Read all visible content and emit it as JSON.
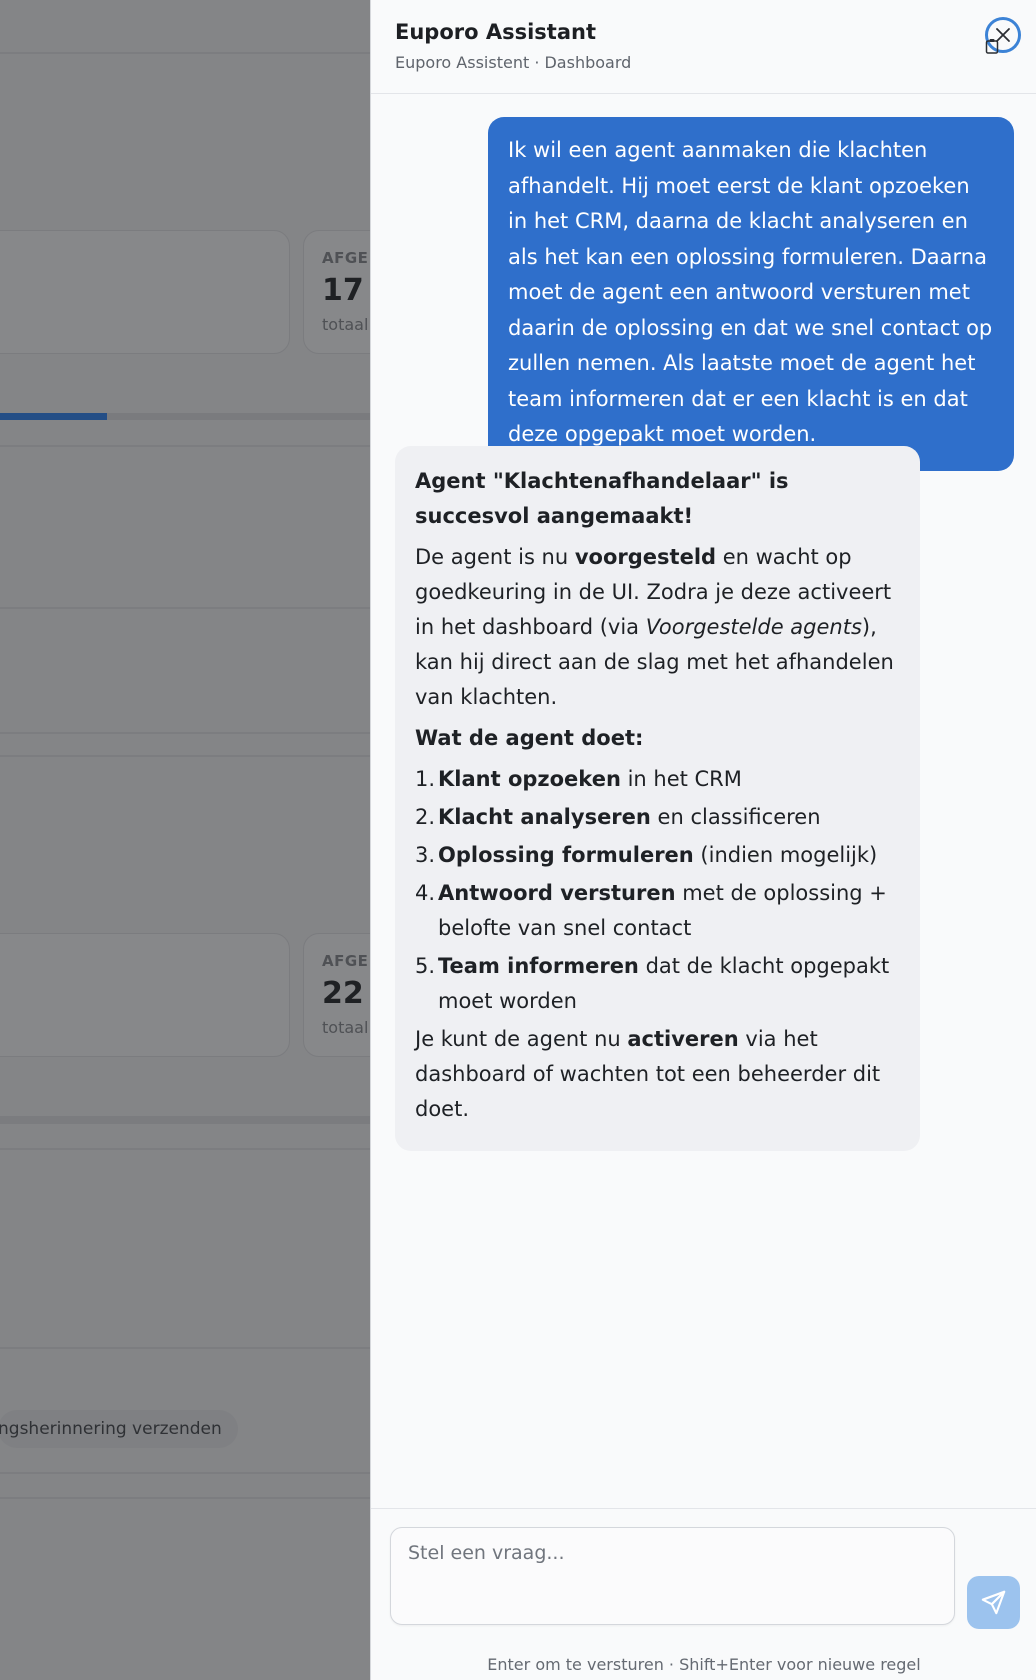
{
  "background": {
    "stat_cards": [
      {
        "label": "AFGE",
        "value": "17",
        "sub": "totaal"
      },
      {
        "label": "AFGE",
        "value": "22",
        "sub": "totaal"
      }
    ],
    "progress_fraction": 0.29,
    "chip_text": "ngsherinnering verzenden"
  },
  "panel": {
    "title": "Euporo Assistant",
    "subtitle": "Euporo Assistent · Dashboard",
    "close_icon": "close-icon",
    "clip_icon": "clipboard-icon"
  },
  "messages": {
    "user_text": "Ik wil een agent aanmaken die klachten afhandelt. Hij moet eerst de klant opzoeken in het CRM, daarna de klacht analyseren en als het kan een oplossing formuleren. Daarna moet de agent een antwoord versturen met daarin de oplossing en dat we snel contact op zullen nemen. Als laatste moet de agent het team informeren dat er een klacht is en dat deze opgepakt moet worden.",
    "bot": {
      "headline": "Agent \"Klachtenafhandelaar\" is succesvol aangemaakt!",
      "p1_before": "De agent is nu ",
      "p1_bold": "voorgesteld",
      "p1_mid": " en wacht op goedkeuring in de UI. Zodra je deze activeert in het dashboard (via ",
      "p1_italic": "Voorgestelde agents",
      "p1_after": "), kan hij direct aan de slag met het afhandelen van klachten.",
      "steps_heading": "Wat de agent doet:",
      "steps": [
        {
          "num": "1.",
          "bold": "Klant opzoeken",
          "rest": " in het CRM"
        },
        {
          "num": "2.",
          "bold": "Klacht analyseren",
          "rest": " en classificeren"
        },
        {
          "num": "3.",
          "bold": "Oplossing formuleren",
          "rest": " (indien mogelijk)"
        },
        {
          "num": "4.",
          "bold": "Antwoord versturen",
          "rest": " met de oplossing + belofte van snel contact"
        },
        {
          "num": "5.",
          "bold": "Team informeren",
          "rest": " dat de klacht opgepakt moet worden"
        }
      ],
      "p2_before": "Je kunt de agent nu ",
      "p2_bold": "activeren",
      "p2_after": " via het dashboard of wachten tot een beheerder dit doet."
    }
  },
  "composer": {
    "placeholder": "Stel een vraag...",
    "value": "",
    "send_icon": "send-icon",
    "hint": "Enter om te versturen · Shift+Enter voor nieuwe regel"
  },
  "colors": {
    "user_bubble": "#2f6fcb",
    "bot_bubble": "#eff0f3",
    "send_button": "#9cc3ee",
    "accent": "#3c83d6"
  }
}
